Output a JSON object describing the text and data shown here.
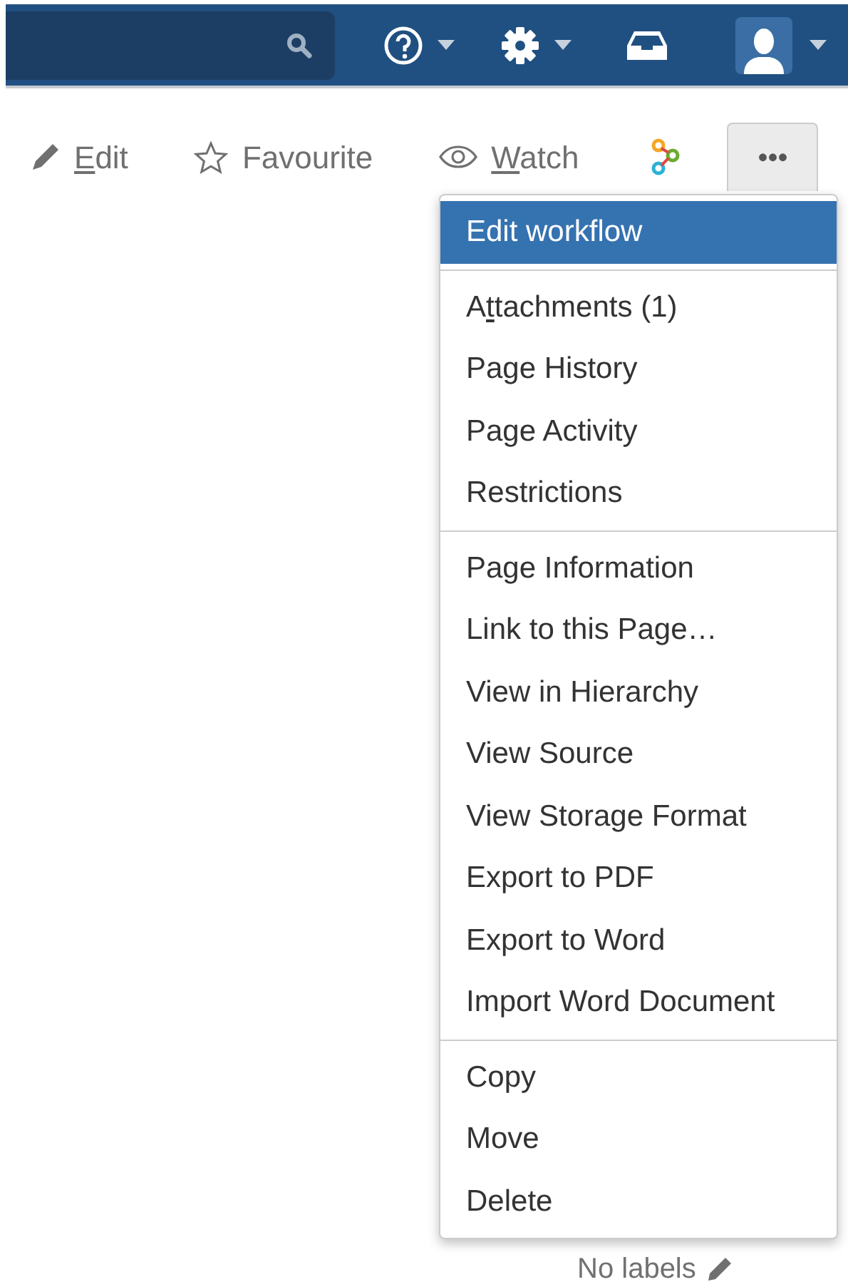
{
  "toolbar": [
    {
      "kind": "edit",
      "access_key": "E",
      "label_rest": "dit"
    },
    {
      "kind": "favourite",
      "label": "Favourite"
    },
    {
      "kind": "watch",
      "access_key": "W",
      "label_rest": "atch"
    },
    {
      "kind": "workflow"
    },
    {
      "kind": "more",
      "label": "•••",
      "expanded": true
    }
  ],
  "menu": {
    "sections": [
      [
        {
          "label": "Edit workflow",
          "selected": true
        }
      ],
      [
        {
          "label_start": "A",
          "access_key": "t",
          "label_rest": "tachments (1)",
          "selected": false
        },
        {
          "label": "Page History",
          "selected": false
        },
        {
          "label": "Page Activity",
          "selected": false
        },
        {
          "label": "Restrictions",
          "selected": false
        }
      ],
      [
        {
          "label": "Page Information",
          "selected": false
        },
        {
          "label": "Link to this Page…",
          "selected": false
        },
        {
          "label": "View in Hierarchy",
          "selected": false
        },
        {
          "label": "View Source",
          "selected": false
        },
        {
          "label": "View Storage Format",
          "selected": false
        },
        {
          "label": "Export to PDF",
          "selected": false
        },
        {
          "label": "Export to Word",
          "selected": false
        },
        {
          "label": "Import Word Document",
          "selected": false
        }
      ],
      [
        {
          "label": "Copy",
          "selected": false
        },
        {
          "label": "Move",
          "selected": false
        },
        {
          "label": "Delete",
          "selected": false
        }
      ]
    ]
  },
  "labels": {
    "text": "No labels"
  }
}
